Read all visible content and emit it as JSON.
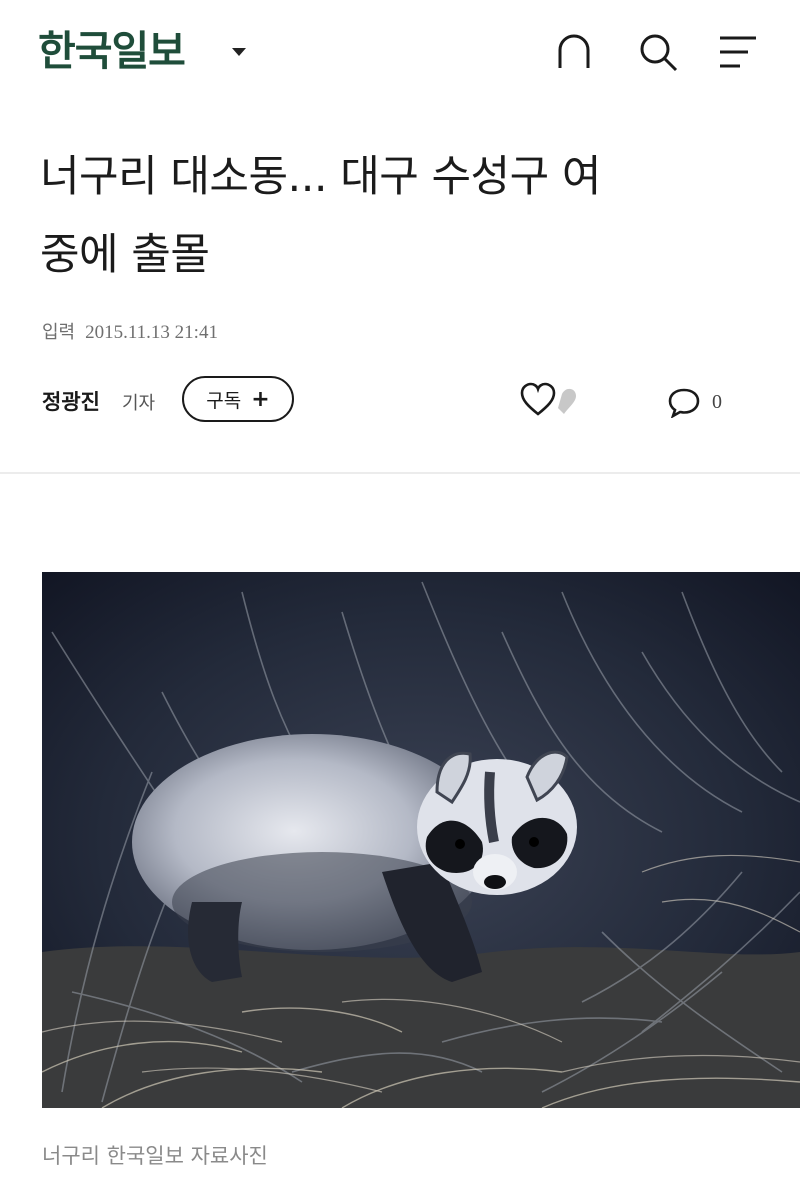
{
  "header": {
    "logo": "한국일보",
    "icons": [
      "home-icon",
      "search-icon",
      "menu-icon"
    ]
  },
  "article": {
    "title_line1": "너구리 대소동... 대구 수성구 여",
    "title_line2": "중에 출몰",
    "date_label": "입력",
    "date_value": "2015.11.13 21:41",
    "author_name": "정광진",
    "author_role": "기자",
    "subscribe_label": "구독",
    "subscribe_plus": "+",
    "comment_count": "0",
    "photo_caption": "너구리 한국일보 자료사진"
  },
  "colors": {
    "brand": "#1f4d3a",
    "text": "#1a1a1a",
    "muted": "#8a8a8a"
  }
}
